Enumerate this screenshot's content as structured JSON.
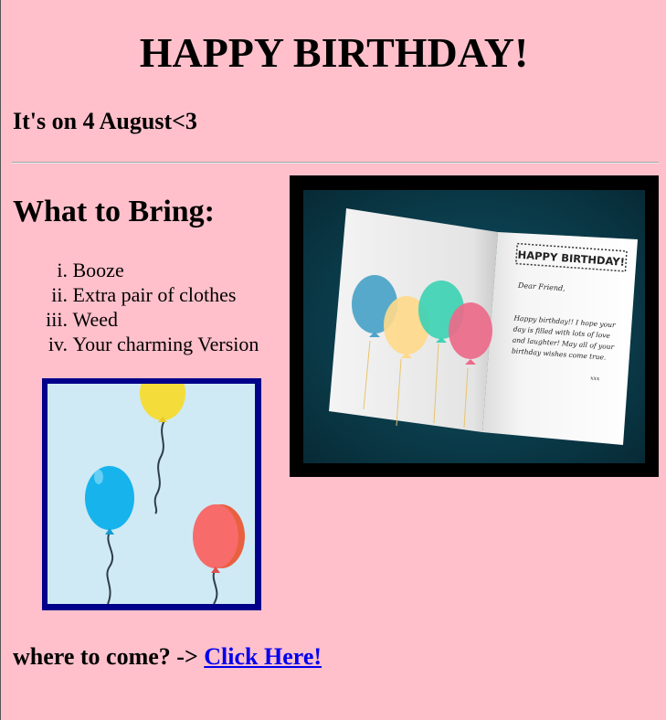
{
  "page": {
    "title": "HAPPY BIRTHDAY!",
    "date_line": "It's on 4 August<3"
  },
  "bring": {
    "heading": "What to Bring:",
    "items": [
      {
        "num": "i.",
        "label": "Booze"
      },
      {
        "num": "ii.",
        "label": "Extra pair of clothes"
      },
      {
        "num": "iii.",
        "label": "Weed"
      },
      {
        "num": "iv.",
        "label": "Your charming Version"
      }
    ]
  },
  "card_image": {
    "card_title": "HAPPY BIRTHDAY!",
    "greeting": "Dear Friend,",
    "message_lines": [
      "Happy birthday!! I hope your",
      "day is filled with lots of love",
      "and laughter! May all of your",
      "birthday wishes come true."
    ],
    "signature": "xxx",
    "balloon_colors": [
      "#4aa3c8",
      "#ffd98a",
      "#3ed3b4",
      "#ec6a8a"
    ]
  },
  "balloons_image": {
    "balloon_colors": [
      "#f4dc3a",
      "#17b3ec",
      "#f76b6b"
    ]
  },
  "footer": {
    "prompt": "where to come? -> ",
    "link_label": "Click Here!"
  },
  "colors": {
    "background": "#ffc0cb",
    "link": "#0000ee",
    "card_frame": "#000000",
    "balloon_frame": "#00008b"
  }
}
